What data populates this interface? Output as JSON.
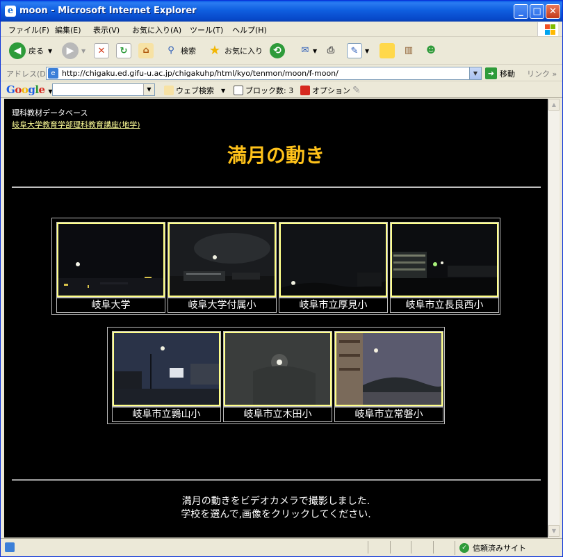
{
  "window": {
    "title": "moon - Microsoft Internet Explorer",
    "minimize": "_",
    "maximize": "□",
    "close": "✕"
  },
  "menu": [
    "ファイル(F)",
    "編集(E)",
    "表示(V)",
    "お気に入り(A)",
    "ツール(T)",
    "ヘルプ(H)"
  ],
  "toolbar": {
    "back_label": "戻る",
    "search_label": "検索",
    "favorites_label": "お気に入り"
  },
  "address": {
    "label": "アドレス(D)",
    "url": "http://chigaku.ed.gifu-u.ac.jp/chigakuhp/html/kyo/tenmon/moon/f-moon/",
    "go_label": "移動",
    "links_label": "リンク"
  },
  "googlebar": {
    "logo": "Google",
    "web_search": "ウェブ検索",
    "block_count": "ブロック数: 3",
    "options": "オプション"
  },
  "page": {
    "header_line1": "理科教材データベース",
    "header_link": "岐阜大学教育学部理科教育講座(地学)",
    "title": "満月の動き",
    "row1": [
      {
        "caption": "岐阜大学"
      },
      {
        "caption": "岐阜大学付属小"
      },
      {
        "caption": "岐阜市立厚見小"
      },
      {
        "caption": "岐阜市立長良西小"
      }
    ],
    "row2": [
      {
        "caption": "岐阜市立鶉山小"
      },
      {
        "caption": "岐阜市立木田小"
      },
      {
        "caption": "岐阜市立常磐小"
      }
    ],
    "footer_line1": "満月の動きをビデオカメラで撮影しました.",
    "footer_line2": "学校を選んで,画像をクリックしてください."
  },
  "status": {
    "zone": "信頼済みサイト"
  }
}
